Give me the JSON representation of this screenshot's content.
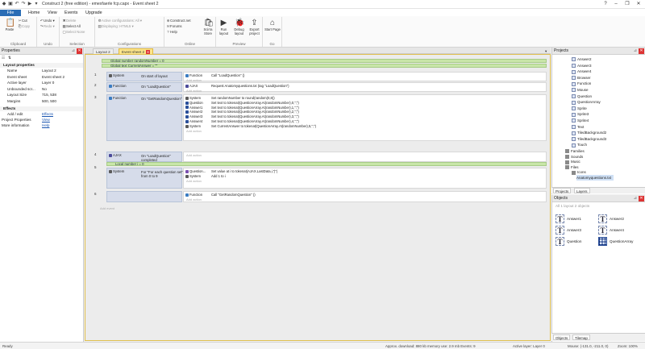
{
  "titlebar": {
    "title": "Construct 2  (free edition) - emexfaerle fcp.capx - Event sheet 2"
  },
  "menu": {
    "file": "File",
    "home": "Home",
    "view": "View",
    "events": "Events",
    "upgrade": "Upgrade"
  },
  "ribbon": {
    "clipboard": {
      "label": "Clipboard",
      "paste": "Paste",
      "cut": "Cut",
      "copy": "Copy"
    },
    "undo": {
      "label": "Undo",
      "undo": "Undo",
      "redo": "Redo"
    },
    "selection": {
      "label": "Selection",
      "delete": "Delete",
      "select_all": "Select All",
      "select_none": "Select None"
    },
    "configurations": {
      "label": "Configurations",
      "active": "Active configurations: All",
      "displaying": "Displaying: HTML5"
    },
    "online": {
      "label": "Online",
      "construct_net": "Construct.net",
      "forums": "Forums",
      "help": "Help",
      "scirra_store": "Scirra Store"
    },
    "preview": {
      "label": "Preview",
      "run": "Run layout",
      "debug": "Debug layout",
      "export": "Export project"
    },
    "go": {
      "label": "Go",
      "start": "Start Page"
    }
  },
  "properties": {
    "title": "Properties",
    "section_layout": "Layout properties",
    "rows": [
      {
        "k": "Name",
        "v": "Layout 2"
      },
      {
        "k": "Event sheet",
        "v": "Event sheet 2"
      },
      {
        "k": "Active layer",
        "v": "Layer 0"
      },
      {
        "k": "Unbounded scr...",
        "v": "No"
      },
      {
        "k": "Layout Size",
        "v": "715, 538"
      },
      {
        "k": "Margins",
        "v": "500, 500"
      }
    ],
    "section_effects": "Effects",
    "add_edit": {
      "k": "Add / edit",
      "v": "Effects"
    },
    "project_props": {
      "k": "Project Properties",
      "v": "View"
    },
    "more_info": {
      "k": "More information",
      "v": "Help"
    }
  },
  "tabs": [
    {
      "label": "Layout 2"
    },
    {
      "label": "Event sheet 2"
    }
  ],
  "sheet": {
    "globals": [
      "Global number randomNumber = 0",
      "Global text CurrentAnswer = \"\""
    ],
    "events": [
      {
        "num": "1",
        "conds": [
          {
            "obj": "System",
            "text": "On start of layout"
          }
        ],
        "acts": [
          {
            "obj": "Function",
            "text": "Call \"LoadQuestion\" ()"
          }
        ]
      },
      {
        "num": "2",
        "conds": [
          {
            "obj": "Function",
            "text": "On \"LoadQuestion\""
          }
        ],
        "acts": [
          {
            "obj": "AJAX",
            "text": "Request Anatomyquestions.txt (tag \"LoadQuestion\")"
          }
        ]
      },
      {
        "num": "3",
        "conds": [
          {
            "obj": "Function",
            "text": "On \"GetRandomQuestion\""
          }
        ],
        "acts": [
          {
            "obj": "System",
            "text": "Set randomNumber to round(random(0,8))"
          },
          {
            "obj": "Question",
            "text": "Set text to tokenat(QuestionArray.At(randomNumber),0,\";\")"
          },
          {
            "obj": "Answer1",
            "text": "Set text to tokenat(QuestionArray.At(randomNumber),1,\";\")"
          },
          {
            "obj": "Answer2",
            "text": "Set text to tokenat(QuestionArray.At(randomNumber),2,\";\")"
          },
          {
            "obj": "Answer3",
            "text": "Set text to tokenat(QuestionArray.At(randomNumber),3,\";\")"
          },
          {
            "obj": "Answer4",
            "text": "Set text to tokenat(QuestionArray.At(randomNumber),4,\";\")"
          },
          {
            "obj": "System",
            "text": "Set CurrentAnswer to tokenat(QuestionArray.At(randomNumber),5,\";\")"
          }
        ]
      },
      {
        "num": "4",
        "conds": [
          {
            "obj": "AJAX",
            "text": "On \"LoadQuestion\" completed"
          }
        ],
        "acts": []
      },
      {
        "num": "5",
        "local": "Local number i = 0",
        "conds": [
          {
            "obj": "System",
            "text": "For \"For each question set\" from 0 to 9"
          }
        ],
        "acts": [
          {
            "obj": "Question...",
            "text": "Set value at i to tokenat(AJAX.LastData,i,\"|\")"
          },
          {
            "obj": "System",
            "text": "Add 1 to i"
          }
        ]
      },
      {
        "num": "6",
        "conds": [],
        "acts": [
          {
            "obj": "Function",
            "text": "Call \"GetRandomQuestion\" ()"
          }
        ]
      }
    ],
    "add_action": "Add action",
    "add_event": "Add event"
  },
  "projects": {
    "title": "Projects",
    "items": [
      "Answer2",
      "Answer3",
      "Answer4",
      "Browser",
      "Function",
      "Mouse",
      "Question",
      "QuestionArray",
      "Sprite",
      "Sprite3",
      "Sprite4",
      "Text",
      "TiledBackground2",
      "TiledBackground3",
      "Touch"
    ],
    "folders": [
      "Families",
      "Sounds",
      "Music",
      "Files"
    ],
    "files_sub": [
      "Icons",
      "Anatomyquestions.txt"
    ],
    "tab_projects": "Projects",
    "tab_layers": "Layers"
  },
  "objects": {
    "title": "Objects",
    "filter": "All 1 layout 2 objects",
    "items": [
      {
        "label": "Answer1",
        "icon": "T"
      },
      {
        "label": "Answer2",
        "icon": "T"
      },
      {
        "label": "Answer3",
        "icon": "T"
      },
      {
        "label": "Answer4",
        "icon": "T"
      },
      {
        "label": "Question",
        "icon": "T"
      },
      {
        "label": "QuestionArray",
        "icon": "grid"
      }
    ],
    "tab_objects": "Objects",
    "tab_tilemap": "Tilemap"
  },
  "status": {
    "ready": "Ready",
    "download": "Approx. download: 880 kb  memory use: 2.9 mb  Events: 9",
    "layer": "Active layer: Layer 0",
    "mouse": "Mouse: (-131.0, -211.0, 0)",
    "zoom": "Zoom: 100%"
  },
  "colors": {
    "file_tab": "#2a6db5",
    "global_var": "#c8e6a8",
    "active_tab": "#fde68a",
    "close_btn": "#dd3333"
  }
}
